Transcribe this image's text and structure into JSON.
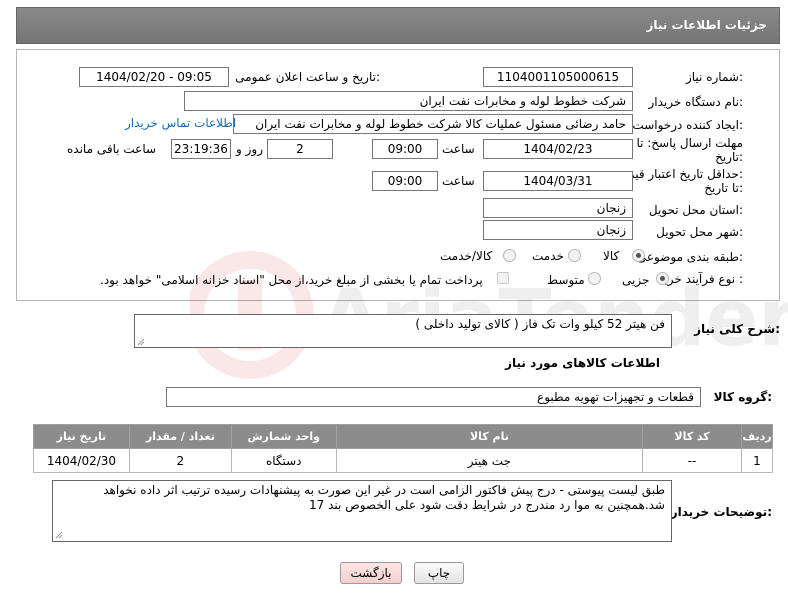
{
  "header": {
    "title": "جزئیات اطلاعات نیاز"
  },
  "form": {
    "need_number_label": "شماره نیاز:",
    "need_number": "1104001105000615",
    "announce_label": "تاریخ و ساعت اعلان عمومی:",
    "announce_value": "1404/02/20 - 09:05",
    "buyer_org_label": "نام دستگاه خریدار:",
    "buyer_org": "شرکت خطوط لوله و مخابرات نفت ایران",
    "creator_label": "ایجاد کننده درخواست:",
    "creator": "حامد  رضائی  مسئول عملیات کالا  شرکت خطوط لوله و مخابرات نفت ایران",
    "contact_link": "اطلاعات تماس خریدار",
    "reply_deadline_label_1": "مهلت ارسال پاسخ: تا",
    "reply_deadline_label_2": "تاریخ:",
    "reply_date": "1404/02/23",
    "time_label": "ساعت",
    "reply_time": "09:00",
    "days_value": "2",
    "days_label": "روز و",
    "remaining_time": "23:19:36",
    "remaining_label": "ساعت باقی مانده",
    "price_deadline_label_1": "حداقل تاریخ اعتبار قیمت:",
    "price_deadline_label_2": "تا تاریخ:",
    "price_date": "1404/03/31",
    "price_time": "09:00",
    "province_label": "استان محل تحویل:",
    "province": "زنجان",
    "city_label": "شهر محل تحویل:",
    "city": "زنجان",
    "category_label": "طبقه بندی موضوعی:",
    "category_options": [
      "کالا",
      "خدمت",
      "کالا/خدمت"
    ],
    "category_selected": "کالا",
    "purchase_type_label": "نوع فرآیند خرید :",
    "purchase_options": [
      "جزیی",
      "متوسط"
    ],
    "purchase_selected": "جزیی",
    "payment_note": "پرداخت تمام یا بخشی از مبلغ خرید،از محل \"اسناد خزانه اسلامی\" خواهد بود."
  },
  "description": {
    "label": "شرح کلی نیاز:",
    "value": "فن هیتر 52 کیلو وات تک فاز ( کالای تولید داخلی )"
  },
  "goods": {
    "section_title": "اطلاعات کالاهای مورد نیاز",
    "group_label": "گروه کالا:",
    "group_value": "قطعات و تجهیزات تهویه مطبوع",
    "columns": [
      "ردیف",
      "کد کالا",
      "نام کالا",
      "واحد شمارش",
      "تعداد / مقدار",
      "تاریخ نیاز"
    ],
    "rows": [
      {
        "row": "1",
        "code": "--",
        "name": "جت هیتر",
        "unit": "دستگاه",
        "qty": "2",
        "date": "1404/02/30"
      }
    ]
  },
  "buyer_notes": {
    "label": "توضیحات خریدار:",
    "line1": "طبق لیست پیوستی - درج پیش فاکتور الزامی است در غیر این صورت به پیشنهادات رسیده ترتیب اثر داده نخواهد",
    "line2": "شد.همچنین به موا رد مندرج در شرایط دقت شود علی الخصوص بند 17"
  },
  "buttons": {
    "print": "چاپ",
    "back": "بازگشت"
  },
  "colors": {
    "header_bg": "#7f7f7f",
    "link": "#1a6bb5",
    "back_button_bg": "#f8dada"
  }
}
